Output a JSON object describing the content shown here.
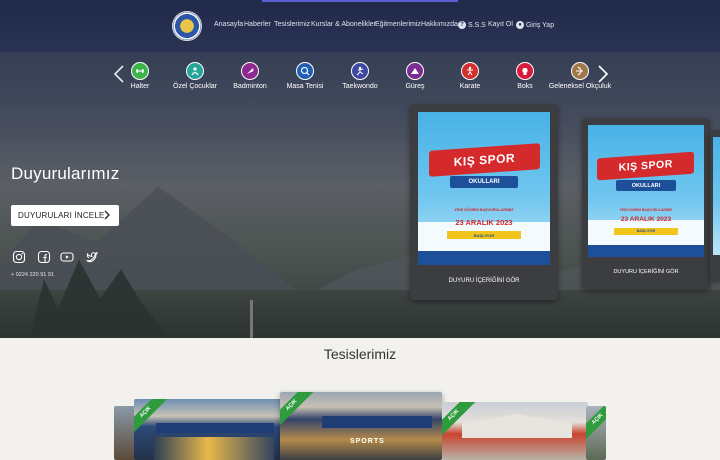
{
  "nav": {
    "items": [
      "Anasayfa",
      "Haberler",
      "Tesislerimiz",
      "Kurslar & Abonelikler",
      "Eğitmenlerimiz",
      "Hakkımızda"
    ],
    "faq_label": "S.S.S",
    "register_label": "Kayıt Ol",
    "login_label": "Giriş Yap"
  },
  "sports": [
    {
      "label": "Halter",
      "icon": "weightlifting-icon",
      "color": "#3cb44a"
    },
    {
      "label": "Özel Çocuklar",
      "icon": "special-kids-icon",
      "color": "#26a69a"
    },
    {
      "label": "Badminton",
      "icon": "badminton-icon",
      "color": "#8e2a8f"
    },
    {
      "label": "Masa Tenisi",
      "icon": "table-tennis-icon",
      "color": "#1e5fb4"
    },
    {
      "label": "Taekwondo",
      "icon": "taekwondo-icon",
      "color": "#3d4aa0"
    },
    {
      "label": "Güreş",
      "icon": "wrestling-icon",
      "color": "#7b2d91"
    },
    {
      "label": "Karate",
      "icon": "karate-icon",
      "color": "#d32f2f"
    },
    {
      "label": "Boks",
      "icon": "boxing-icon",
      "color": "#d81b3c"
    },
    {
      "label": "Geleneksel Okçuluk",
      "icon": "archery-icon",
      "color": "#a0784a"
    }
  ],
  "hero": {
    "title": "Duyurularımız",
    "button_label": "DUYURULARI İNCELE",
    "phone": "+ 0224 220 91 91",
    "social": [
      "instagram-icon",
      "facebook-icon",
      "youtube-icon",
      "twitter-icon"
    ]
  },
  "announcements": [
    {
      "poster_title": "KIŞ SPOR",
      "poster_subtitle": "OKULLARI",
      "poster_note": "YENİ DÖNEM BAŞVURULARIMIZ",
      "poster_date": "23 ARALIK 2023",
      "poster_tag": "BAŞLIYOR",
      "caption": "DUYURU İÇERİĞİNİ GÖR"
    },
    {
      "poster_title": "KIŞ SPOR",
      "poster_subtitle": "OKULLARI",
      "poster_note": "YENİ DÖNEM BAŞVURULARIMIZ",
      "poster_date": "23 ARALIK 2023",
      "poster_tag": "BAŞLIYOR",
      "caption": "DUYURU İÇERİĞİNİ GÖR"
    }
  ],
  "facilities": {
    "title": "Tesislerimiz",
    "badge": "AÇIK",
    "sign_text": "SPORTS"
  },
  "colors": {
    "topbar": "#2a3354",
    "accent": "#5b5fd6",
    "open_badge": "#2e9b3c",
    "poster_red": "#d42a2c",
    "poster_blue": "#1d4f9a"
  }
}
